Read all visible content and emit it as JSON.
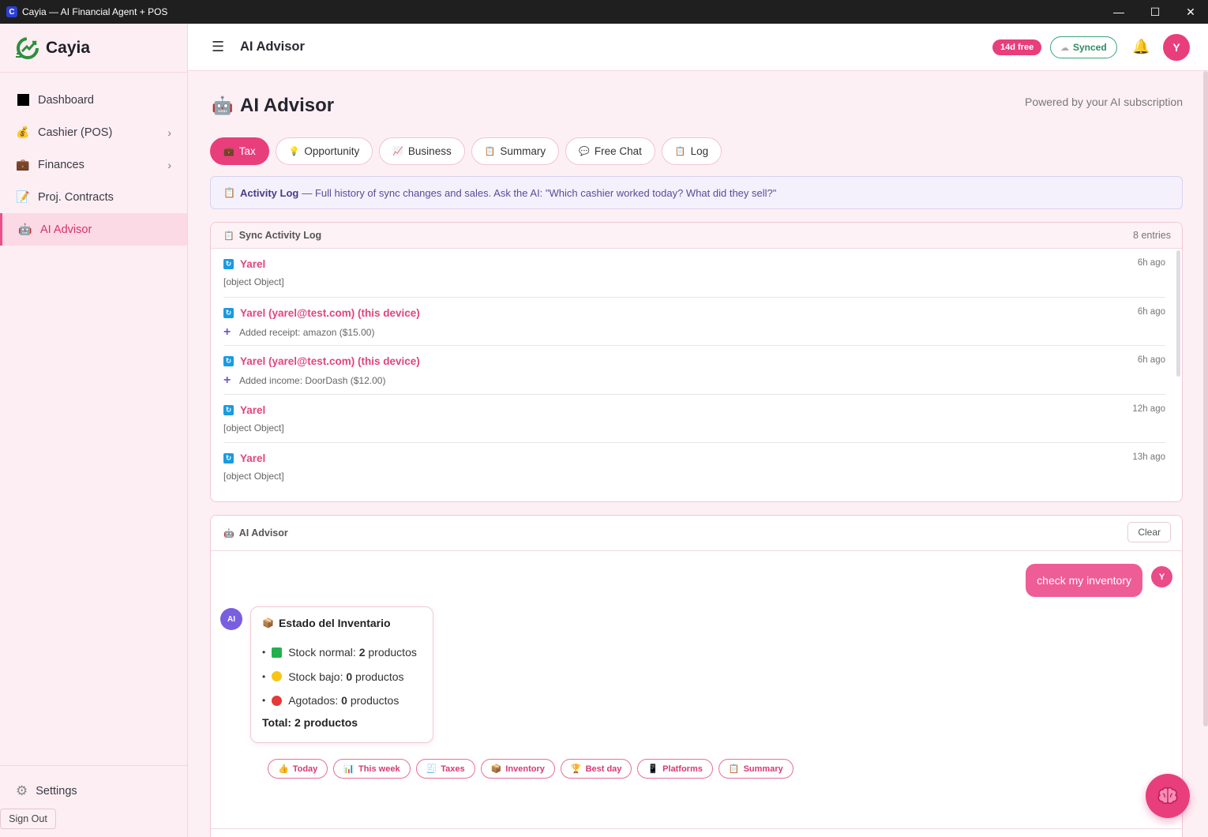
{
  "window": {
    "title": "Cayia — AI Financial Agent + POS",
    "app_letter": "C"
  },
  "sidebar": {
    "brand": "Cayia",
    "items": [
      {
        "label": "Dashboard",
        "icon": "square-icon"
      },
      {
        "label": "Cashier (POS)",
        "icon": "money-bag-icon"
      },
      {
        "label": "Finances",
        "icon": "briefcase-icon"
      },
      {
        "label": "Proj. Contracts",
        "icon": "contract-icon"
      },
      {
        "label": "AI Advisor",
        "icon": "robot-icon"
      }
    ],
    "settings_label": "Settings",
    "signout_label": "Sign Out"
  },
  "header": {
    "title": "AI Advisor",
    "trial_badge": "14d free",
    "sync_badge": "Synced",
    "avatar_letter": "Y"
  },
  "page": {
    "title": "AI Advisor",
    "powered_by": "Powered by your AI subscription",
    "tabs": [
      {
        "label": "Tax",
        "icon": "💼"
      },
      {
        "label": "Opportunity",
        "icon": "💡"
      },
      {
        "label": "Business",
        "icon": "📈"
      },
      {
        "label": "Summary",
        "icon": "📋"
      },
      {
        "label": "Free Chat",
        "icon": "💬"
      },
      {
        "label": "Log",
        "icon": "📋"
      }
    ],
    "banner_bold": "Activity Log",
    "banner_text": "— Full history of sync changes and sales. Ask the AI: \"Which cashier worked today? What did they sell?\""
  },
  "log": {
    "title": "Sync Activity Log",
    "count": "8 entries",
    "entries": [
      {
        "who": "Yarel",
        "when": "6h ago",
        "what": "[object Object]"
      },
      {
        "who": "Yarel (yarel@test.com) (this device)",
        "when": "6h ago",
        "what": "Added receipt: amazon ($15.00)"
      },
      {
        "who": "Yarel (yarel@test.com) (this device)",
        "when": "6h ago",
        "what": "Added income: DoorDash ($12.00)"
      },
      {
        "who": "Yarel",
        "when": "12h ago",
        "what": "[object Object]"
      },
      {
        "who": "Yarel",
        "when": "13h ago",
        "what": "[object Object]"
      }
    ]
  },
  "chat": {
    "title": "AI Advisor",
    "clear_label": "Clear",
    "user_message": "check my inventory",
    "user_avatar": "Y",
    "ai_avatar": "AI",
    "ai_reply": {
      "heading": "Estado del Inventario",
      "lines": [
        {
          "prefix": "Stock normal: ",
          "count": "2",
          "suffix": " productos",
          "color": "#22b14c"
        },
        {
          "prefix": "Stock bajo: ",
          "count": "0",
          "suffix": " productos",
          "color": "#f5c518"
        },
        {
          "prefix": "Agotados: ",
          "count": "0",
          "suffix": " productos",
          "color": "#e53935"
        }
      ],
      "total": "Total: 2 productos"
    },
    "quick_chips": [
      {
        "label": "Today",
        "icon": "👍"
      },
      {
        "label": "This week",
        "icon": "📊"
      },
      {
        "label": "Taxes",
        "icon": "🧾"
      },
      {
        "label": "Inventory",
        "icon": "📦"
      },
      {
        "label": "Best day",
        "icon": "🏆"
      },
      {
        "label": "Platforms",
        "icon": "📱"
      },
      {
        "label": "Summary",
        "icon": "📋"
      }
    ]
  },
  "colors": {
    "accent": "#e83e7c",
    "sidebar_bg": "#fdeef3",
    "ai_purple": "#7a5ee0"
  }
}
